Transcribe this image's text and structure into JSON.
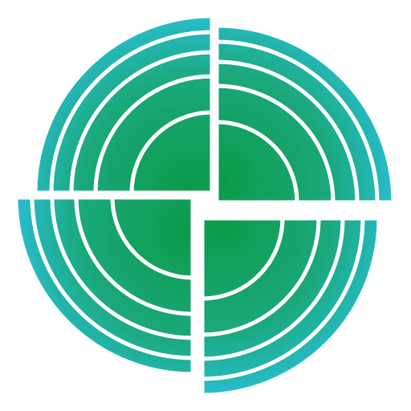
{
  "logo": {
    "icon": "radial-target-logo-icon",
    "colors": {
      "center": "#0c9a48",
      "mid": "#1aa87a",
      "edge": "#2cc3e6",
      "gap": "#ffffff"
    }
  }
}
